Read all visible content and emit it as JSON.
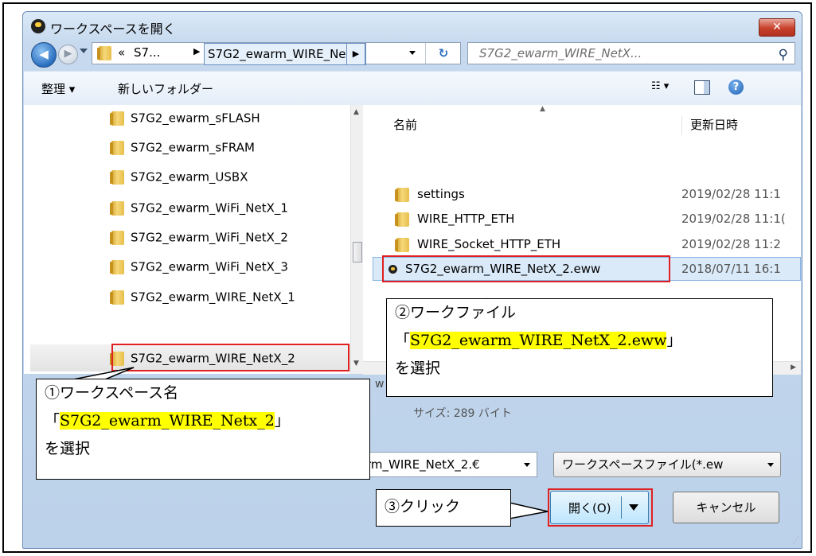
{
  "window": {
    "title": "ワークスペースを開く",
    "close_label": "✕"
  },
  "address": {
    "chevron": "«",
    "segment1": "S7...",
    "segment2": "S7G2_ewarm_WIRE_Net...",
    "search_placeholder": "S7G2_ewarm_WIRE_NetX..."
  },
  "toolbar": {
    "organize_label": "整理 ▾",
    "new_folder_label": "新しいフォルダー",
    "view_label": "☷ ▾"
  },
  "left_pane": {
    "items": [
      {
        "label": "S7G2_ewarm_sFLASH"
      },
      {
        "label": "S7G2_ewarm_sFRAM"
      },
      {
        "label": "S7G2_ewarm_USBX"
      },
      {
        "label": "S7G2_ewarm_WiFi_NetX_1"
      },
      {
        "label": "S7G2_ewarm_WiFi_NetX_2"
      },
      {
        "label": "S7G2_ewarm_WiFi_NetX_3"
      },
      {
        "label": "S7G2_ewarm_WIRE_NetX_1"
      },
      {
        "label": "S7G2_ewarm_WIRE_NetX_2"
      }
    ]
  },
  "file_list": {
    "columns": {
      "name": "名前",
      "modified": "更新日時"
    },
    "rows": [
      {
        "name": "settings",
        "modified": "2019/02/28 11:1",
        "type": "folder"
      },
      {
        "name": "WIRE_HTTP_ETH",
        "modified": "2019/02/28 11:1(",
        "type": "folder"
      },
      {
        "name": "WIRE_Socket_HTTP_ETH",
        "modified": "2019/02/28 11:2",
        "type": "folder"
      },
      {
        "name": "S7G2_ewarm_WIRE_NetX_2.eww",
        "modified": "2018/07/11 16:1",
        "type": "eww"
      }
    ]
  },
  "details": {
    "partial_text": "w",
    "size": "サイズ: 289 バイト"
  },
  "footer": {
    "file_name_value": "rm_WIRE_NetX_2.€",
    "file_type_value": "ワークスペースファイル(*.ew",
    "open_label": "開く(O)",
    "cancel_label": "キャンセル"
  },
  "callouts": {
    "c1_line1": "①ワークスペース名",
    "c1_open": "「",
    "c1_name": "S7G2_ewarm_WIRE_Netx_2",
    "c1_close": "」",
    "c1_line3": "を選択",
    "c2_line1": "②ワークファイル",
    "c2_open": "「",
    "c2_name": "S7G2_ewarm_WIRE_NetX_2.eww",
    "c2_close": "」",
    "c2_line3": "を選択",
    "c3_text": "③クリック"
  },
  "colors": {
    "highlight": "#ffff00",
    "annotation_red": "#e02020",
    "selection_blue": "#dbeaf9"
  }
}
